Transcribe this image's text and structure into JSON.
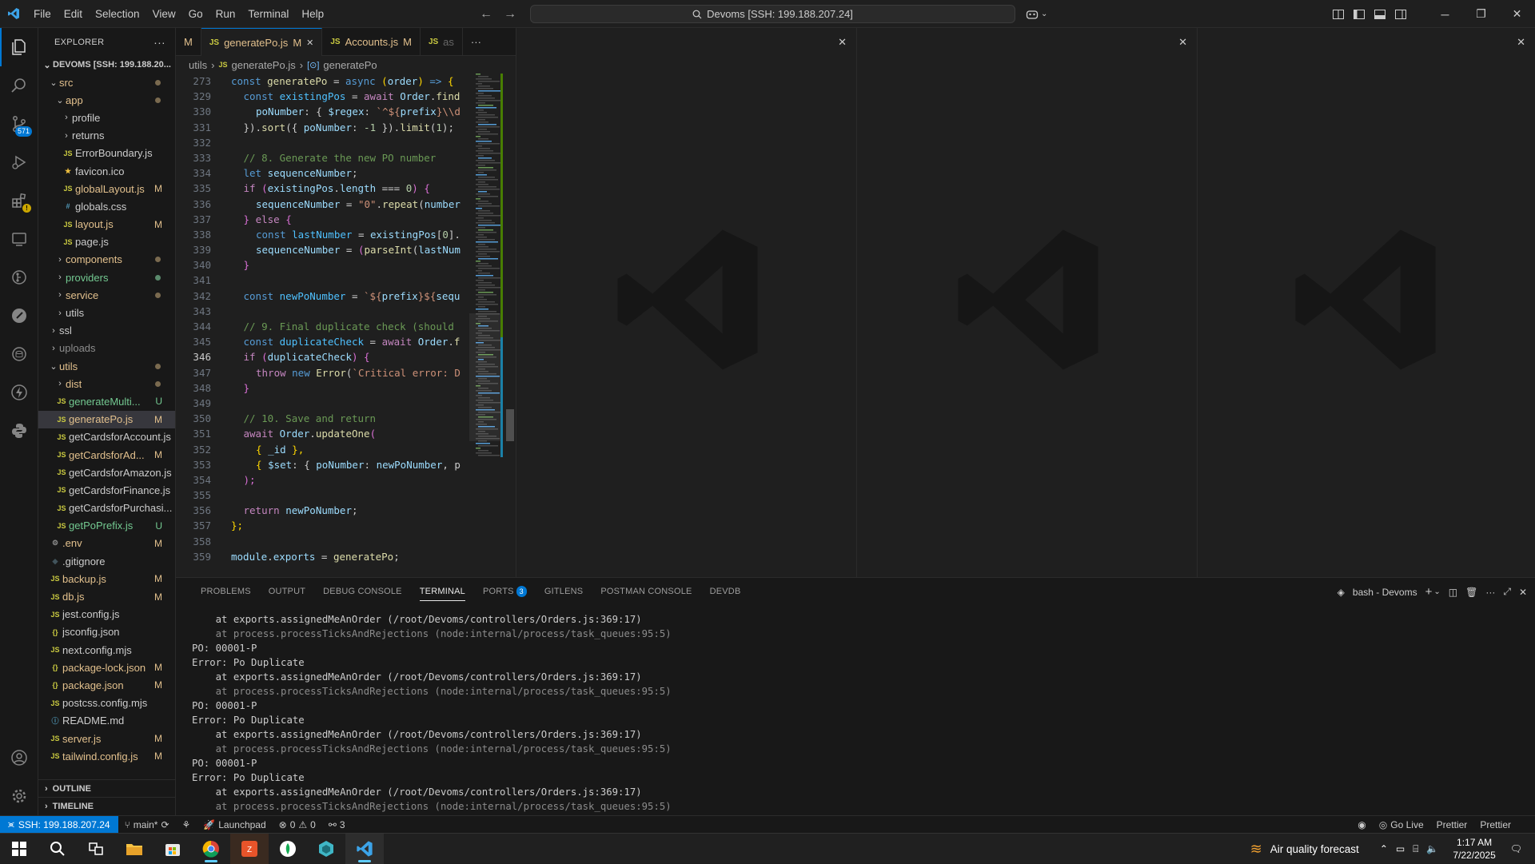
{
  "titlebar": {
    "menu": [
      "File",
      "Edit",
      "Selection",
      "View",
      "Go",
      "Run",
      "Terminal",
      "Help"
    ],
    "command_center": "Devoms [SSH: 199.188.207.24]"
  },
  "activity": {
    "scm_badge": "571"
  },
  "explorer": {
    "title": "EXPLORER",
    "root": "DEVOMS [SSH: 199.188.20...",
    "items": [
      {
        "label": "src",
        "kind": "folder-open",
        "depth": 1,
        "mark": "dot",
        "color": "mod"
      },
      {
        "label": "app",
        "kind": "folder-open",
        "depth": 2,
        "mark": "dot",
        "color": "mod"
      },
      {
        "label": "profile",
        "kind": "folder",
        "depth": 3,
        "mark": "",
        "color": "def"
      },
      {
        "label": "returns",
        "kind": "folder",
        "depth": 3,
        "mark": "",
        "color": "def"
      },
      {
        "label": "ErrorBoundary.js",
        "kind": "js",
        "depth": 3,
        "mark": "",
        "color": "def"
      },
      {
        "label": "favicon.ico",
        "kind": "star",
        "depth": 3,
        "mark": "",
        "color": "def"
      },
      {
        "label": "globalLayout.js",
        "kind": "js",
        "depth": 3,
        "mark": "M",
        "color": "mod"
      },
      {
        "label": "globals.css",
        "kind": "css",
        "depth": 3,
        "mark": "",
        "color": "def"
      },
      {
        "label": "layout.js",
        "kind": "js",
        "depth": 3,
        "mark": "M",
        "color": "mod"
      },
      {
        "label": "page.js",
        "kind": "js",
        "depth": 3,
        "mark": "",
        "color": "def"
      },
      {
        "label": "components",
        "kind": "folder",
        "depth": 2,
        "mark": "dot",
        "color": "mod"
      },
      {
        "label": "providers",
        "kind": "folder",
        "depth": 2,
        "mark": "dot",
        "color": "untr"
      },
      {
        "label": "service",
        "kind": "folder",
        "depth": 2,
        "mark": "dot",
        "color": "mod"
      },
      {
        "label": "utils",
        "kind": "folder",
        "depth": 2,
        "mark": "",
        "color": "def"
      },
      {
        "label": "ssl",
        "kind": "folder",
        "depth": 1,
        "mark": "",
        "color": "def"
      },
      {
        "label": "uploads",
        "kind": "folder",
        "depth": 1,
        "mark": "",
        "color": "dim"
      },
      {
        "label": "utils",
        "kind": "folder-open",
        "depth": 1,
        "mark": "dot",
        "color": "mod"
      },
      {
        "label": "dist",
        "kind": "folder",
        "depth": 2,
        "mark": "dot",
        "color": "mod"
      },
      {
        "label": "generateMulti...",
        "kind": "js",
        "depth": 2,
        "mark": "U",
        "color": "untr"
      },
      {
        "label": "generatePo.js",
        "kind": "js",
        "depth": 2,
        "mark": "M",
        "color": "mod",
        "selected": true
      },
      {
        "label": "getCardsforAccount.js",
        "kind": "js",
        "depth": 2,
        "mark": "",
        "color": "def"
      },
      {
        "label": "getCardsforAd...",
        "kind": "js",
        "depth": 2,
        "mark": "M",
        "color": "mod"
      },
      {
        "label": "getCardsforAmazon.js",
        "kind": "js",
        "depth": 2,
        "mark": "",
        "color": "def"
      },
      {
        "label": "getCardsforFinance.js",
        "kind": "js",
        "depth": 2,
        "mark": "",
        "color": "def"
      },
      {
        "label": "getCardsforPurchasi...",
        "kind": "js",
        "depth": 2,
        "mark": "",
        "color": "def"
      },
      {
        "label": "getPoPrefix.js",
        "kind": "js",
        "depth": 2,
        "mark": "U",
        "color": "untr"
      },
      {
        "label": ".env",
        "kind": "gear",
        "depth": 1,
        "mark": "M",
        "color": "mod"
      },
      {
        "label": ".gitignore",
        "kind": "git",
        "depth": 1,
        "mark": "",
        "color": "def"
      },
      {
        "label": "backup.js",
        "kind": "js",
        "depth": 1,
        "mark": "M",
        "color": "mod"
      },
      {
        "label": "db.js",
        "kind": "js",
        "depth": 1,
        "mark": "M",
        "color": "mod"
      },
      {
        "label": "jest.config.js",
        "kind": "js",
        "depth": 1,
        "mark": "",
        "color": "def"
      },
      {
        "label": "jsconfig.json",
        "kind": "json",
        "depth": 1,
        "mark": "",
        "color": "def"
      },
      {
        "label": "next.config.mjs",
        "kind": "js",
        "depth": 1,
        "mark": "",
        "color": "def"
      },
      {
        "label": "package-lock.json",
        "kind": "json",
        "depth": 1,
        "mark": "M",
        "color": "mod"
      },
      {
        "label": "package.json",
        "kind": "json",
        "depth": 1,
        "mark": "M",
        "color": "mod"
      },
      {
        "label": "postcss.config.mjs",
        "kind": "js",
        "depth": 1,
        "mark": "",
        "color": "def"
      },
      {
        "label": "README.md",
        "kind": "info",
        "depth": 1,
        "mark": "",
        "color": "def"
      },
      {
        "label": "server.js",
        "kind": "js",
        "depth": 1,
        "mark": "M",
        "color": "mod"
      },
      {
        "label": "tailwind.config.js",
        "kind": "js",
        "depth": 1,
        "mark": "M",
        "color": "mod"
      }
    ],
    "outline": "OUTLINE",
    "timeline": "TIMELINE"
  },
  "tabs": [
    {
      "label": "M",
      "status": "",
      "prefix": "",
      "active": false
    },
    {
      "label": "generatePo.js",
      "status": "M",
      "prefix": "JS",
      "active": true
    },
    {
      "label": "Accounts.js",
      "status": "M",
      "prefix": "JS",
      "active": false
    },
    {
      "label": "as",
      "status": "",
      "prefix": "JS",
      "active": false
    }
  ],
  "breadcrumb": [
    "utils",
    "generatePo.js",
    "generatePo"
  ],
  "editor": {
    "current_line": "346",
    "lines": [
      {
        "n": "273",
        "t": [
          [
            "const ",
            "k"
          ],
          [
            "generatePo",
            "f"
          ],
          [
            " = ",
            "d"
          ],
          [
            "async ",
            "k"
          ],
          [
            "(",
            "y"
          ],
          [
            "order",
            "v"
          ],
          [
            ") ",
            "y"
          ],
          [
            "=> ",
            "k"
          ],
          [
            "{",
            "y"
          ]
        ],
        "indent": 0,
        "sticky": true
      },
      {
        "n": "329",
        "t": [
          [
            "const ",
            "k"
          ],
          [
            "existingPos",
            "cy"
          ],
          [
            " = ",
            "d"
          ],
          [
            "await ",
            "kc"
          ],
          [
            "Order",
            "v"
          ],
          [
            ".",
            "d"
          ],
          [
            "find",
            "f"
          ]
        ],
        "indent": 1
      },
      {
        "n": "330",
        "t": [
          [
            "poNumber",
            "v"
          ],
          [
            ": { ",
            "d"
          ],
          [
            "$regex",
            "v"
          ],
          [
            ": ",
            "d"
          ],
          [
            "`^${",
            "s"
          ],
          [
            "prefix",
            "v"
          ],
          [
            "}\\\\d",
            "s"
          ]
        ],
        "indent": 2
      },
      {
        "n": "331",
        "t": [
          [
            "}).",
            "d"
          ],
          [
            "sort",
            "f"
          ],
          [
            "({ ",
            "d"
          ],
          [
            "poNumber",
            "v"
          ],
          [
            ": ",
            "d"
          ],
          [
            "-1",
            "n"
          ],
          [
            " }).",
            "d"
          ],
          [
            "limit",
            "f"
          ],
          [
            "(",
            "d"
          ],
          [
            "1",
            "n"
          ],
          [
            ");",
            "d"
          ]
        ],
        "indent": 1
      },
      {
        "n": "332",
        "t": [],
        "indent": 0
      },
      {
        "n": "333",
        "t": [
          [
            "// 8. Generate the new PO number",
            "cm"
          ]
        ],
        "indent": 1
      },
      {
        "n": "334",
        "t": [
          [
            "let ",
            "k"
          ],
          [
            "sequenceNumber",
            "v"
          ],
          [
            ";",
            "d"
          ]
        ],
        "indent": 1
      },
      {
        "n": "335",
        "t": [
          [
            "if ",
            "kc"
          ],
          [
            "(",
            "p"
          ],
          [
            "existingPos",
            "v"
          ],
          [
            ".",
            "d"
          ],
          [
            "length",
            "v"
          ],
          [
            " === ",
            "d"
          ],
          [
            "0",
            "n"
          ],
          [
            ") ",
            "p"
          ],
          [
            "{",
            "p"
          ]
        ],
        "indent": 1
      },
      {
        "n": "336",
        "t": [
          [
            "sequenceNumber",
            "v"
          ],
          [
            " = ",
            "d"
          ],
          [
            "\"0\"",
            "s"
          ],
          [
            ".",
            "d"
          ],
          [
            "repeat",
            "f"
          ],
          [
            "(",
            "d"
          ],
          [
            "number",
            "v"
          ]
        ],
        "indent": 2
      },
      {
        "n": "337",
        "t": [
          [
            "} ",
            "p"
          ],
          [
            "else ",
            "kc"
          ],
          [
            "{",
            "p"
          ]
        ],
        "indent": 1
      },
      {
        "n": "338",
        "t": [
          [
            "const ",
            "k"
          ],
          [
            "lastNumber",
            "cy"
          ],
          [
            " = ",
            "d"
          ],
          [
            "existingPos",
            "v"
          ],
          [
            "[",
            "d"
          ],
          [
            "0",
            "n"
          ],
          [
            "].",
            "d"
          ]
        ],
        "indent": 2
      },
      {
        "n": "339",
        "t": [
          [
            "sequenceNumber",
            "v"
          ],
          [
            " = ",
            "d"
          ],
          [
            "(",
            "p"
          ],
          [
            "parseInt",
            "f"
          ],
          [
            "(",
            "d"
          ],
          [
            "lastNum",
            "v"
          ]
        ],
        "indent": 2
      },
      {
        "n": "340",
        "t": [
          [
            "}",
            "p"
          ]
        ],
        "indent": 1
      },
      {
        "n": "341",
        "t": [],
        "indent": 0
      },
      {
        "n": "342",
        "t": [
          [
            "const ",
            "k"
          ],
          [
            "newPoNumber",
            "cy"
          ],
          [
            " = ",
            "d"
          ],
          [
            "`${",
            "s"
          ],
          [
            "prefix",
            "v"
          ],
          [
            "}${",
            "s"
          ],
          [
            "sequ",
            "v"
          ]
        ],
        "indent": 1
      },
      {
        "n": "343",
        "t": [],
        "indent": 0
      },
      {
        "n": "344",
        "t": [
          [
            "// 9. Final duplicate check (should",
            "cm"
          ]
        ],
        "indent": 1
      },
      {
        "n": "345",
        "t": [
          [
            "const ",
            "k"
          ],
          [
            "duplicateCheck",
            "cy"
          ],
          [
            " = ",
            "d"
          ],
          [
            "await ",
            "kc"
          ],
          [
            "Order",
            "v"
          ],
          [
            ".",
            "d"
          ],
          [
            "f",
            "f"
          ]
        ],
        "indent": 1
      },
      {
        "n": "346",
        "t": [
          [
            "if ",
            "kc"
          ],
          [
            "(",
            "p"
          ],
          [
            "duplicateCheck",
            "v"
          ],
          [
            ") ",
            "p"
          ],
          [
            "{",
            "p"
          ]
        ],
        "indent": 1
      },
      {
        "n": "347",
        "t": [
          [
            "throw ",
            "kc"
          ],
          [
            "new ",
            "k"
          ],
          [
            "Error",
            "f"
          ],
          [
            "(",
            "d"
          ],
          [
            "`Critical error: D",
            "s"
          ]
        ],
        "indent": 2
      },
      {
        "n": "348",
        "t": [
          [
            "}",
            "p"
          ]
        ],
        "indent": 1
      },
      {
        "n": "349",
        "t": [],
        "indent": 0
      },
      {
        "n": "350",
        "t": [
          [
            "// 10. Save and return",
            "cm"
          ]
        ],
        "indent": 1
      },
      {
        "n": "351",
        "t": [
          [
            "await ",
            "kc"
          ],
          [
            "Order",
            "v"
          ],
          [
            ".",
            "d"
          ],
          [
            "updateOne",
            "f"
          ],
          [
            "(",
            "p"
          ]
        ],
        "indent": 1
      },
      {
        "n": "352",
        "t": [
          [
            "{ ",
            "y"
          ],
          [
            "_id",
            "v"
          ],
          [
            " },",
            "y"
          ]
        ],
        "indent": 2
      },
      {
        "n": "353",
        "t": [
          [
            "{ ",
            "y"
          ],
          [
            "$set",
            "v"
          ],
          [
            ": { ",
            "d"
          ],
          [
            "poNumber",
            "v"
          ],
          [
            ": ",
            "d"
          ],
          [
            "newPoNumber",
            "v"
          ],
          [
            ", p",
            "d"
          ]
        ],
        "indent": 2
      },
      {
        "n": "354",
        "t": [
          [
            ");",
            "p"
          ]
        ],
        "indent": 1
      },
      {
        "n": "355",
        "t": [],
        "indent": 0
      },
      {
        "n": "356",
        "t": [
          [
            "return ",
            "kc"
          ],
          [
            "newPoNumber",
            "v"
          ],
          [
            ";",
            "d"
          ]
        ],
        "indent": 1
      },
      {
        "n": "357",
        "t": [
          [
            "};",
            "y"
          ]
        ],
        "indent": 0
      },
      {
        "n": "358",
        "t": [],
        "indent": 0
      },
      {
        "n": "359",
        "t": [
          [
            "module",
            "v"
          ],
          [
            ".",
            "d"
          ],
          [
            "exports",
            "v"
          ],
          [
            " = ",
            "d"
          ],
          [
            "generatePo",
            "f"
          ],
          [
            ";",
            "d"
          ]
        ],
        "indent": 0
      }
    ]
  },
  "panel": {
    "tabs": [
      "PROBLEMS",
      "OUTPUT",
      "DEBUG CONSOLE",
      "TERMINAL",
      "PORTS",
      "GITLENS",
      "POSTMAN CONSOLE",
      "DEVDB"
    ],
    "active_tab": "TERMINAL",
    "ports_badge": "3",
    "terminal_name": "bash - Devoms",
    "terminal_lines": [
      {
        "text": "    at exports.assignedMeAnOrder (/root/Devoms/controllers/Orders.js:369:17)",
        "dim": false
      },
      {
        "text": "    at process.processTicksAndRejections (node:internal/process/task_queues:95:5)",
        "dim": true
      },
      {
        "text": "PO: 00001-P",
        "dim": false
      },
      {
        "text": "Error: Po Duplicate",
        "dim": false
      },
      {
        "text": "    at exports.assignedMeAnOrder (/root/Devoms/controllers/Orders.js:369:17)",
        "dim": false
      },
      {
        "text": "    at process.processTicksAndRejections (node:internal/process/task_queues:95:5)",
        "dim": true
      },
      {
        "text": "PO: 00001-P",
        "dim": false
      },
      {
        "text": "Error: Po Duplicate",
        "dim": false
      },
      {
        "text": "    at exports.assignedMeAnOrder (/root/Devoms/controllers/Orders.js:369:17)",
        "dim": false
      },
      {
        "text": "    at process.processTicksAndRejections (node:internal/process/task_queues:95:5)",
        "dim": true
      },
      {
        "text": "PO: 00001-P",
        "dim": false
      },
      {
        "text": "Error: Po Duplicate",
        "dim": false
      },
      {
        "text": "    at exports.assignedMeAnOrder (/root/Devoms/controllers/Orders.js:369:17)",
        "dim": false
      },
      {
        "text": "    at process.processTicksAndRejections (node:internal/process/task_queues:95:5)",
        "dim": true
      }
    ]
  },
  "statusbar": {
    "remote": "SSH: 199.188.207.24",
    "branch": "main*",
    "launchpad": "Launchpad",
    "errors": "0",
    "warnings": "0",
    "ports": "3",
    "go_live": "Go Live",
    "prettier1": "Prettier",
    "prettier2": "Prettier"
  },
  "taskbar": {
    "weather": "Air quality forecast",
    "time": "1:17 AM",
    "date": "7/22/2025"
  },
  "colors": {
    "accent": "#0078d4",
    "modified": "#e2c08d",
    "untracked": "#73c991",
    "js": "#cbcb41"
  }
}
